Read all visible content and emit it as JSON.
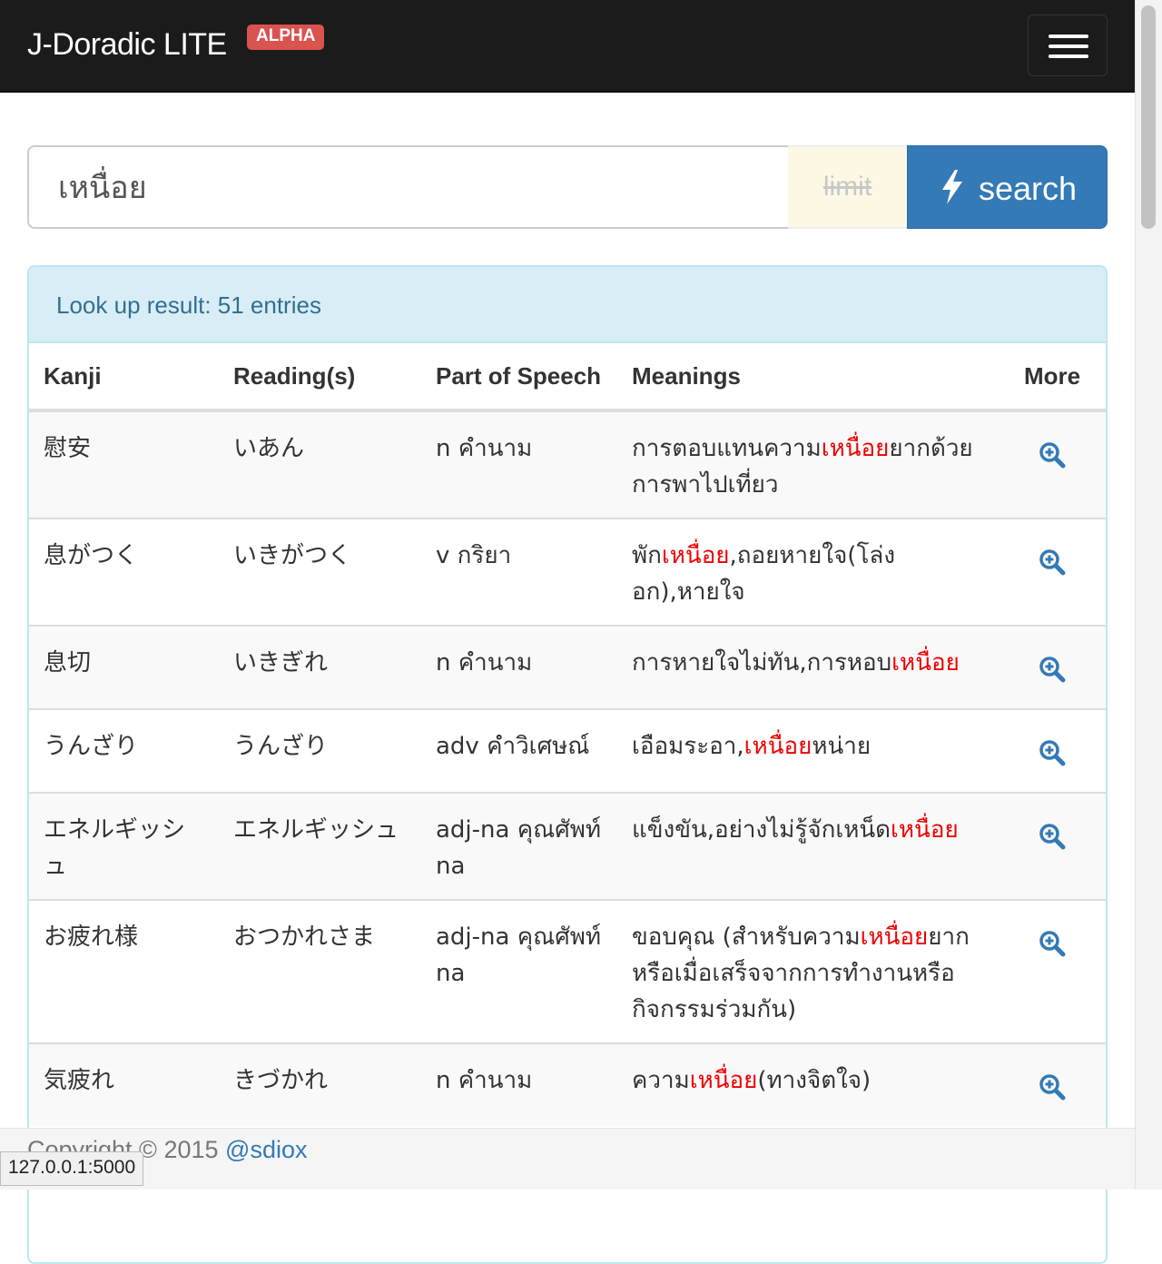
{
  "navbar": {
    "brand": "J-Doradic LITE",
    "badge": "ALPHA"
  },
  "search": {
    "query": "เหนื่อย",
    "limit_label": "limit",
    "button_label": "search"
  },
  "results": {
    "summary": "Look up result: 51 entries",
    "columns": [
      "Kanji",
      "Reading(s)",
      "Part of Speech",
      "Meanings",
      "More"
    ],
    "highlight": "เหนื่อย",
    "rows": [
      {
        "kanji": "慰安",
        "reading": "いあん",
        "pos": "n คำนาม",
        "meaning_parts": [
          "การตอบแทนความ",
          "เหนื่อย",
          "ยากด้วยการพาไปเที่ยว"
        ]
      },
      {
        "kanji": "息がつく",
        "reading": "いきがつく",
        "pos": "v กริยา",
        "meaning_parts": [
          "พัก",
          "เหนื่อย",
          ",ถอยหายใจ(โล่งอก),หายใจ"
        ]
      },
      {
        "kanji": "息切",
        "reading": "いきぎれ",
        "pos": "n คำนาม",
        "meaning_parts": [
          "การหายใจไม่ทัน,การหอบ",
          "เหนื่อย",
          ""
        ]
      },
      {
        "kanji": "うんざり",
        "reading": "うんざり",
        "pos": "adv คำวิเศษณ์",
        "meaning_parts": [
          "เอือมระอา,",
          "เหนื่อย",
          "หน่าย"
        ]
      },
      {
        "kanji": "エネルギッシュ",
        "reading": "エネルギッシュ",
        "pos": "adj-na คุณศัพท์ na",
        "meaning_parts": [
          "แข็งขัน,อย่างไม่รู้จักเหน็ด",
          "เหนื่อย",
          ""
        ]
      },
      {
        "kanji": "お疲れ様",
        "reading": "おつかれさま",
        "pos": "adj-na คุณศัพท์ na",
        "meaning_parts": [
          "ขอบคุณ (สำหรับความ",
          "เหนื่อย",
          "ยากหรือเมื่อเสร็จจากการทำงานหรือกิจกรรมร่วมกัน)"
        ]
      },
      {
        "kanji": "気疲れ",
        "reading": "きづかれ",
        "pos": "n คำนาม",
        "meaning_parts": [
          "ความ",
          "เหนื่อย",
          "(ทางจิตใจ)"
        ]
      }
    ]
  },
  "footer": {
    "copyright": "Copyright © 2015 ",
    "author": "@sdiox"
  },
  "statusbar": {
    "url": "127.0.0.1:5000"
  },
  "colors": {
    "navbar": "#1b1b1b",
    "primary": "#337ab7",
    "highlight": "#ee0000",
    "panel_info": "#d9edf7"
  },
  "icons": {
    "search_button": "bolt-icon",
    "more": "zoom-in-icon",
    "menu": "hamburger-icon"
  }
}
